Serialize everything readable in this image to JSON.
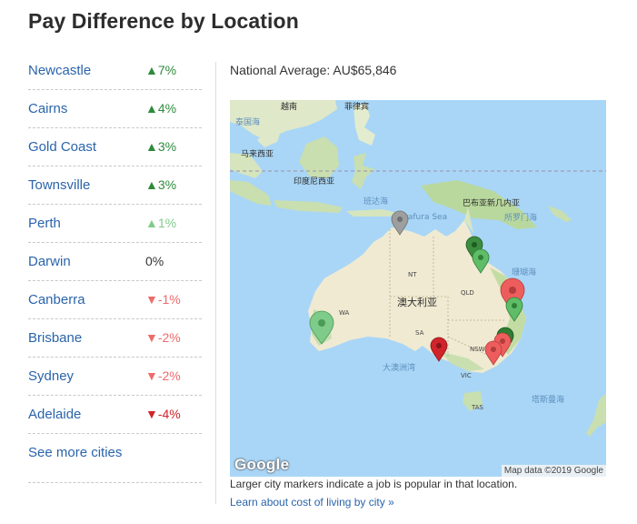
{
  "title": "Pay Difference by Location",
  "colors": {
    "link": "#2a64ab",
    "up_strong": "#2e8b3c",
    "up_light": "#7fcb89",
    "down_strong": "#d0242b",
    "down_light": "#ef6b6b",
    "neutral": "#333333"
  },
  "cities": [
    {
      "name": "Newcastle",
      "change": "▲7%",
      "trend": "up_strong"
    },
    {
      "name": "Cairns",
      "change": "▲4%",
      "trend": "up_strong"
    },
    {
      "name": "Gold Coast",
      "change": "▲3%",
      "trend": "up_strong"
    },
    {
      "name": "Townsville",
      "change": "▲3%",
      "trend": "up_strong"
    },
    {
      "name": "Perth",
      "change": "▲1%",
      "trend": "up_light"
    },
    {
      "name": "Darwin",
      "change": "0%",
      "trend": "neutral"
    },
    {
      "name": "Canberra",
      "change": "▼-1%",
      "trend": "down_light"
    },
    {
      "name": "Brisbane",
      "change": "▼-2%",
      "trend": "down_light"
    },
    {
      "name": "Sydney",
      "change": "▼-2%",
      "trend": "down_light"
    },
    {
      "name": "Adelaide",
      "change": "▼-4%",
      "trend": "down_strong"
    }
  ],
  "see_more": "See more cities",
  "national_average": "National Average: AU$65,846",
  "map": {
    "labels": {
      "vietnam": "越南",
      "philippines": "菲律宾",
      "hainan": "泰国海",
      "malaysia": "马来西亚",
      "indonesia": "印度尼西亚",
      "banda": "班达海",
      "arafura": "Arafura Sea",
      "png": "巴布亚新几内亚",
      "bismarck": "所罗门海",
      "coral": "珊瑚海",
      "australia": "澳大利亚",
      "indian_ocean": "大澳洲湾",
      "tasman": "塔斯曼海",
      "nt": "NT",
      "wa": "WA",
      "qld": "QLD",
      "sa": "SA",
      "nsw": "NSW",
      "vic": "VIC",
      "tas": "TAS"
    },
    "google": "Google",
    "attribution": "Map data ©2019 Google"
  },
  "caption": "Larger city markers indicate a job is popular in that location.",
  "learn_more": "Learn about cost of living by city »"
}
